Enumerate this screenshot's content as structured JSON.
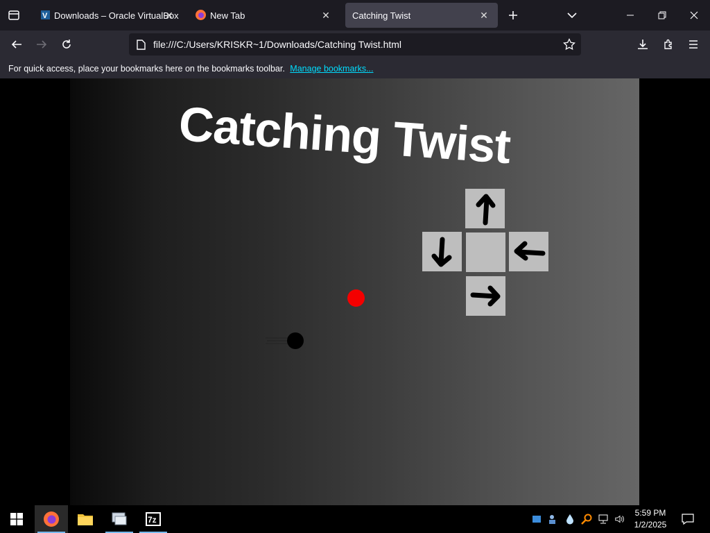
{
  "browser": {
    "tabs": [
      {
        "title": "Downloads – Oracle VirtualBox",
        "active": false
      },
      {
        "title": "New Tab",
        "active": false
      },
      {
        "title": "Catching Twist",
        "active": true
      }
    ],
    "url": "file:///C:/Users/KRISKR~1/Downloads/Catching Twist.html",
    "bookmarks_bar": {
      "message": "For quick access, place your bookmarks here on the bookmarks toolbar.",
      "link": "Manage bookmarks..."
    }
  },
  "game": {
    "title": "Catching Twist",
    "controls": [
      {
        "position": "top",
        "arrow": "up"
      },
      {
        "position": "left",
        "arrow": "down"
      },
      {
        "position": "center",
        "arrow": "none"
      },
      {
        "position": "right",
        "arrow": "left"
      },
      {
        "position": "bottom",
        "arrow": "right"
      }
    ],
    "target_color": "#f40000",
    "ball_color": "#000000"
  },
  "taskbar": {
    "apps": [
      "start-icon",
      "firefox-icon",
      "file-explorer-icon",
      "control-panel-icon",
      "7zip-icon"
    ],
    "clock": {
      "time": "5:59 PM",
      "date": "1/2/2025"
    }
  },
  "colors": {
    "tab_strip": "#1c1b22",
    "toolbar": "#2b2a33",
    "active_tab": "#42414d",
    "link": "#00ddff",
    "tile": "#bebebe"
  }
}
